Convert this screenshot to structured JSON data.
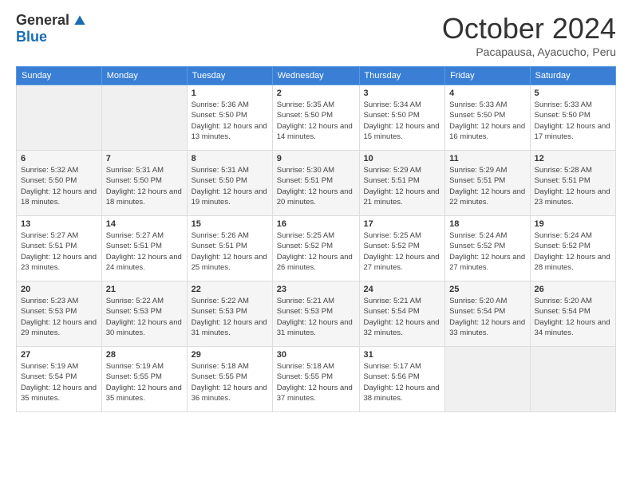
{
  "header": {
    "logo": {
      "general": "General",
      "blue": "Blue"
    },
    "title": "October 2024",
    "location": "Pacapausa, Ayacucho, Peru"
  },
  "days_of_week": [
    "Sunday",
    "Monday",
    "Tuesday",
    "Wednesday",
    "Thursday",
    "Friday",
    "Saturday"
  ],
  "weeks": [
    [
      {
        "day": "",
        "sunrise": "",
        "sunset": "",
        "daylight": ""
      },
      {
        "day": "",
        "sunrise": "",
        "sunset": "",
        "daylight": ""
      },
      {
        "day": "1",
        "sunrise": "Sunrise: 5:36 AM",
        "sunset": "Sunset: 5:50 PM",
        "daylight": "Daylight: 12 hours and 13 minutes."
      },
      {
        "day": "2",
        "sunrise": "Sunrise: 5:35 AM",
        "sunset": "Sunset: 5:50 PM",
        "daylight": "Daylight: 12 hours and 14 minutes."
      },
      {
        "day": "3",
        "sunrise": "Sunrise: 5:34 AM",
        "sunset": "Sunset: 5:50 PM",
        "daylight": "Daylight: 12 hours and 15 minutes."
      },
      {
        "day": "4",
        "sunrise": "Sunrise: 5:33 AM",
        "sunset": "Sunset: 5:50 PM",
        "daylight": "Daylight: 12 hours and 16 minutes."
      },
      {
        "day": "5",
        "sunrise": "Sunrise: 5:33 AM",
        "sunset": "Sunset: 5:50 PM",
        "daylight": "Daylight: 12 hours and 17 minutes."
      }
    ],
    [
      {
        "day": "6",
        "sunrise": "Sunrise: 5:32 AM",
        "sunset": "Sunset: 5:50 PM",
        "daylight": "Daylight: 12 hours and 18 minutes."
      },
      {
        "day": "7",
        "sunrise": "Sunrise: 5:31 AM",
        "sunset": "Sunset: 5:50 PM",
        "daylight": "Daylight: 12 hours and 18 minutes."
      },
      {
        "day": "8",
        "sunrise": "Sunrise: 5:31 AM",
        "sunset": "Sunset: 5:50 PM",
        "daylight": "Daylight: 12 hours and 19 minutes."
      },
      {
        "day": "9",
        "sunrise": "Sunrise: 5:30 AM",
        "sunset": "Sunset: 5:51 PM",
        "daylight": "Daylight: 12 hours and 20 minutes."
      },
      {
        "day": "10",
        "sunrise": "Sunrise: 5:29 AM",
        "sunset": "Sunset: 5:51 PM",
        "daylight": "Daylight: 12 hours and 21 minutes."
      },
      {
        "day": "11",
        "sunrise": "Sunrise: 5:29 AM",
        "sunset": "Sunset: 5:51 PM",
        "daylight": "Daylight: 12 hours and 22 minutes."
      },
      {
        "day": "12",
        "sunrise": "Sunrise: 5:28 AM",
        "sunset": "Sunset: 5:51 PM",
        "daylight": "Daylight: 12 hours and 23 minutes."
      }
    ],
    [
      {
        "day": "13",
        "sunrise": "Sunrise: 5:27 AM",
        "sunset": "Sunset: 5:51 PM",
        "daylight": "Daylight: 12 hours and 23 minutes."
      },
      {
        "day": "14",
        "sunrise": "Sunrise: 5:27 AM",
        "sunset": "Sunset: 5:51 PM",
        "daylight": "Daylight: 12 hours and 24 minutes."
      },
      {
        "day": "15",
        "sunrise": "Sunrise: 5:26 AM",
        "sunset": "Sunset: 5:51 PM",
        "daylight": "Daylight: 12 hours and 25 minutes."
      },
      {
        "day": "16",
        "sunrise": "Sunrise: 5:25 AM",
        "sunset": "Sunset: 5:52 PM",
        "daylight": "Daylight: 12 hours and 26 minutes."
      },
      {
        "day": "17",
        "sunrise": "Sunrise: 5:25 AM",
        "sunset": "Sunset: 5:52 PM",
        "daylight": "Daylight: 12 hours and 27 minutes."
      },
      {
        "day": "18",
        "sunrise": "Sunrise: 5:24 AM",
        "sunset": "Sunset: 5:52 PM",
        "daylight": "Daylight: 12 hours and 27 minutes."
      },
      {
        "day": "19",
        "sunrise": "Sunrise: 5:24 AM",
        "sunset": "Sunset: 5:52 PM",
        "daylight": "Daylight: 12 hours and 28 minutes."
      }
    ],
    [
      {
        "day": "20",
        "sunrise": "Sunrise: 5:23 AM",
        "sunset": "Sunset: 5:53 PM",
        "daylight": "Daylight: 12 hours and 29 minutes."
      },
      {
        "day": "21",
        "sunrise": "Sunrise: 5:22 AM",
        "sunset": "Sunset: 5:53 PM",
        "daylight": "Daylight: 12 hours and 30 minutes."
      },
      {
        "day": "22",
        "sunrise": "Sunrise: 5:22 AM",
        "sunset": "Sunset: 5:53 PM",
        "daylight": "Daylight: 12 hours and 31 minutes."
      },
      {
        "day": "23",
        "sunrise": "Sunrise: 5:21 AM",
        "sunset": "Sunset: 5:53 PM",
        "daylight": "Daylight: 12 hours and 31 minutes."
      },
      {
        "day": "24",
        "sunrise": "Sunrise: 5:21 AM",
        "sunset": "Sunset: 5:54 PM",
        "daylight": "Daylight: 12 hours and 32 minutes."
      },
      {
        "day": "25",
        "sunrise": "Sunrise: 5:20 AM",
        "sunset": "Sunset: 5:54 PM",
        "daylight": "Daylight: 12 hours and 33 minutes."
      },
      {
        "day": "26",
        "sunrise": "Sunrise: 5:20 AM",
        "sunset": "Sunset: 5:54 PM",
        "daylight": "Daylight: 12 hours and 34 minutes."
      }
    ],
    [
      {
        "day": "27",
        "sunrise": "Sunrise: 5:19 AM",
        "sunset": "Sunset: 5:54 PM",
        "daylight": "Daylight: 12 hours and 35 minutes."
      },
      {
        "day": "28",
        "sunrise": "Sunrise: 5:19 AM",
        "sunset": "Sunset: 5:55 PM",
        "daylight": "Daylight: 12 hours and 35 minutes."
      },
      {
        "day": "29",
        "sunrise": "Sunrise: 5:18 AM",
        "sunset": "Sunset: 5:55 PM",
        "daylight": "Daylight: 12 hours and 36 minutes."
      },
      {
        "day": "30",
        "sunrise": "Sunrise: 5:18 AM",
        "sunset": "Sunset: 5:55 PM",
        "daylight": "Daylight: 12 hours and 37 minutes."
      },
      {
        "day": "31",
        "sunrise": "Sunrise: 5:17 AM",
        "sunset": "Sunset: 5:56 PM",
        "daylight": "Daylight: 12 hours and 38 minutes."
      },
      {
        "day": "",
        "sunrise": "",
        "sunset": "",
        "daylight": ""
      },
      {
        "day": "",
        "sunrise": "",
        "sunset": "",
        "daylight": ""
      }
    ]
  ]
}
